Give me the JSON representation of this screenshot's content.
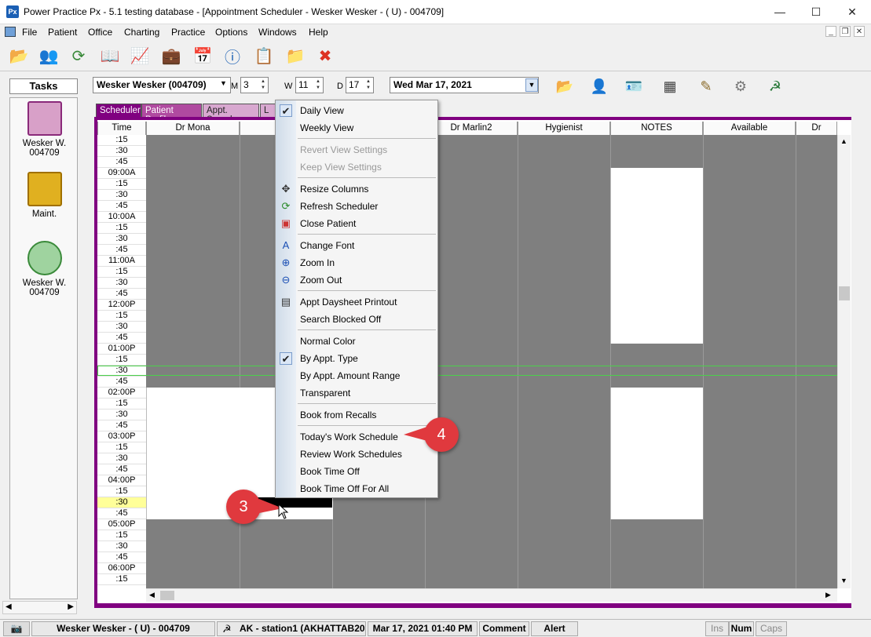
{
  "window": {
    "title": "Power Practice Px - 5.1 testing database - [Appointment Scheduler - Wesker Wesker - ( U) - 004709]",
    "app_icon": "Px"
  },
  "menus": [
    "File",
    "Patient",
    "Office",
    "Charting",
    "Practice",
    "Options",
    "Windows",
    "Help"
  ],
  "tasks": {
    "label": "Tasks",
    "items": [
      {
        "line1": "Wesker W.",
        "line2": "004709",
        "icon": "book-icon"
      },
      {
        "line1": "Maint.",
        "line2": "",
        "icon": "toolbox-icon"
      },
      {
        "line1": "Wesker W.",
        "line2": "004709",
        "icon": "recycle-icon"
      }
    ]
  },
  "scheduler": {
    "patient": "Wesker Wesker (004709)",
    "m_label": "M",
    "m_value": "3",
    "w_label": "W",
    "w_value": "11",
    "d_label": "D",
    "d_value": "17",
    "date": "Wed  Mar 17, 2021",
    "tabs": [
      "Scheduler",
      "Patient Profile",
      "Appt. Search",
      "L"
    ],
    "columns": [
      "Time",
      "Dr Mona",
      "Dr",
      "Dr Marlin2",
      "Hygienist",
      "NOTES",
      "Available",
      "Dr"
    ],
    "times": [
      ":15",
      ":30",
      ":45",
      "09:00A",
      ":15",
      ":30",
      ":45",
      "10:00A",
      ":15",
      ":30",
      ":45",
      "11:00A",
      ":15",
      ":30",
      ":45",
      "12:00P",
      ":15",
      ":30",
      ":45",
      "01:00P",
      ":15",
      ":30",
      ":45",
      "02:00P",
      ":15",
      ":30",
      ":45",
      "03:00P",
      ":15",
      ":30",
      ":45",
      "04:00P",
      ":15",
      ":30",
      ":45",
      "05:00P",
      ":15",
      ":30",
      ":45",
      "06:00P",
      ":15"
    ],
    "highlight_time_index": 33
  },
  "context_menu": {
    "items": [
      {
        "label": "Daily View",
        "checked": true,
        "disabled": false,
        "icon": "check-icon"
      },
      {
        "label": "Weekly View",
        "checked": false,
        "disabled": false,
        "icon": ""
      },
      {
        "sep": true
      },
      {
        "label": "Revert View Settings",
        "disabled": true,
        "icon": ""
      },
      {
        "label": "Keep View Settings",
        "disabled": true,
        "icon": ""
      },
      {
        "sep": true
      },
      {
        "label": "Resize Columns",
        "disabled": false,
        "icon": "move-icon"
      },
      {
        "label": "Refresh Scheduler",
        "disabled": false,
        "icon": "refresh-icon"
      },
      {
        "label": "Close Patient",
        "disabled": false,
        "icon": "close-patient-icon"
      },
      {
        "sep": true
      },
      {
        "label": "Change Font",
        "disabled": false,
        "icon": "font-icon"
      },
      {
        "label": "Zoom In",
        "disabled": false,
        "icon": "zoom-in-icon"
      },
      {
        "label": "Zoom Out",
        "disabled": false,
        "icon": "zoom-out-icon"
      },
      {
        "sep": true
      },
      {
        "label": "Appt Daysheet Printout",
        "disabled": false,
        "icon": "document-icon"
      },
      {
        "label": "Search Blocked Off",
        "disabled": false,
        "icon": ""
      },
      {
        "sep": true
      },
      {
        "label": "Normal Color",
        "disabled": false,
        "icon": ""
      },
      {
        "label": "By Appt. Type",
        "checked": true,
        "disabled": false,
        "icon": "check-icon"
      },
      {
        "label": "By Appt. Amount Range",
        "disabled": false,
        "icon": ""
      },
      {
        "label": "Transparent",
        "disabled": false,
        "icon": ""
      },
      {
        "sep": true
      },
      {
        "label": "Book from Recalls",
        "disabled": false,
        "icon": ""
      },
      {
        "sep": true
      },
      {
        "label": "Today's Work Schedule",
        "disabled": false,
        "icon": ""
      },
      {
        "label": "Review Work Schedules",
        "disabled": false,
        "icon": ""
      },
      {
        "label": "Book Time Off",
        "disabled": false,
        "icon": ""
      },
      {
        "label": "Book Time Off For All",
        "disabled": false,
        "icon": ""
      }
    ]
  },
  "callouts": [
    "3",
    "4"
  ],
  "status": {
    "patient": "Wesker Wesker - ( U) - 004709",
    "station": "AK - station1 (AKHATTAB20",
    "datetime": "Mar 17, 2021 01:40 PM",
    "comment": "Comment",
    "alert": "Alert",
    "ins": "Ins",
    "num": "Num",
    "caps": "Caps"
  },
  "colors": {
    "accent": "#800080",
    "callout": "#e0393e",
    "grid_blocked": "#7f7f7f",
    "highlight": "#ffff99"
  }
}
